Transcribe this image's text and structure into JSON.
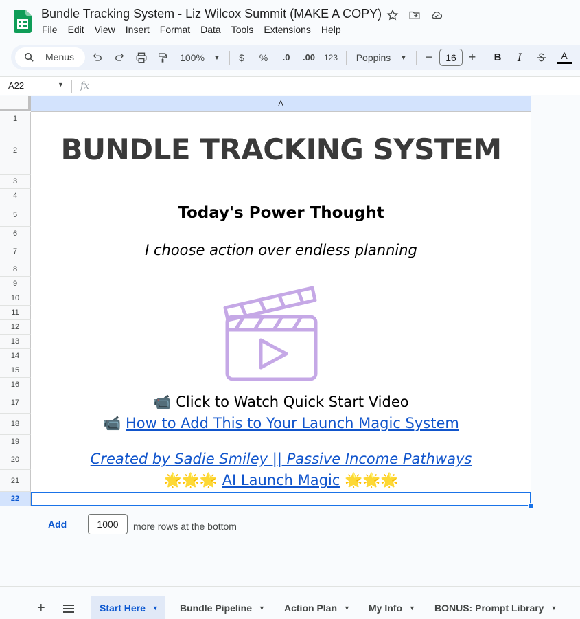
{
  "app": {
    "doc_title": "Bundle Tracking System - Liz Wilcox Summit (MAKE A COPY)",
    "menu": [
      "File",
      "Edit",
      "View",
      "Insert",
      "Format",
      "Data",
      "Tools",
      "Extensions",
      "Help"
    ]
  },
  "toolbar": {
    "search_label": "Menus",
    "zoom": "100%",
    "currency": "$",
    "percent": "%",
    "dec_decrease": ".0",
    "dec_increase": ".00",
    "number_format": "123",
    "font": "Poppins",
    "font_size": "16",
    "minus": "−",
    "plus": "+",
    "bold": "B",
    "italic": "I",
    "text_color": "A"
  },
  "formula": {
    "cell_ref": "A22",
    "fx": "fx"
  },
  "grid": {
    "column": "A",
    "rows": [
      "1",
      "2",
      "3",
      "4",
      "5",
      "6",
      "7",
      "8",
      "9",
      "10",
      "11",
      "12",
      "13",
      "14",
      "15",
      "16",
      "17",
      "18",
      "19",
      "20",
      "21",
      "22"
    ],
    "selected_row": "22"
  },
  "content": {
    "title": "BUNDLE TRACKING SYSTEM",
    "power_heading": "Today's Power Thought",
    "power_quote": "I choose action over endless planning",
    "video_emoji": "📹",
    "video_text": " Click to Watch Quick Start Video",
    "link_emoji": "📹",
    "link_text": "How to Add This to Your Launch Magic System",
    "credit": "Created by Sadie Smiley || Passive Income Pathways",
    "stars_left": "🌟🌟🌟",
    "magic_link": "AI Launch Magic",
    "stars_right": "🌟🌟🌟",
    "clapper_color": "#c5a8e6"
  },
  "add_rows": {
    "button": "Add",
    "count": "1000",
    "suffix": "more rows at the bottom"
  },
  "tabs": [
    {
      "label": "Start Here",
      "active": true
    },
    {
      "label": "Bundle Pipeline",
      "active": false
    },
    {
      "label": "Action Plan",
      "active": false
    },
    {
      "label": "My Info",
      "active": false
    },
    {
      "label": "BONUS: Prompt Library",
      "active": false
    }
  ],
  "colors": {
    "accent": "#0b57d0",
    "link": "#1155cc",
    "selection": "#1a73e8",
    "sheets_green": "#0f9d58"
  }
}
